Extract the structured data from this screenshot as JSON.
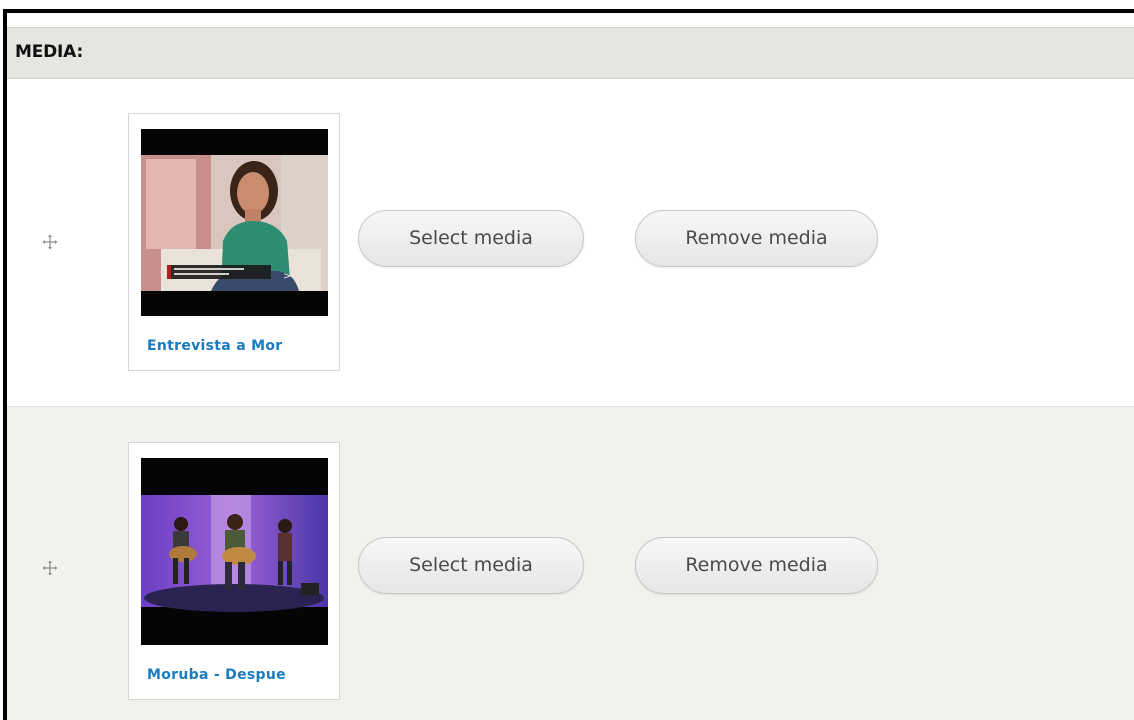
{
  "section": {
    "title": "MEDIA:"
  },
  "media_items": [
    {
      "caption": "Entrevista a Mor",
      "select_label": "Select media",
      "remove_label": "Remove media"
    },
    {
      "caption": "Moruba - Despue",
      "select_label": "Select media",
      "remove_label": "Remove media"
    }
  ],
  "icons": {
    "drag_handle": "drag-handle-icon"
  },
  "colors": {
    "header_bg": "#e5e5e1",
    "link": "#1a7bbd",
    "row_alt_bg": "#f1f1ed"
  }
}
